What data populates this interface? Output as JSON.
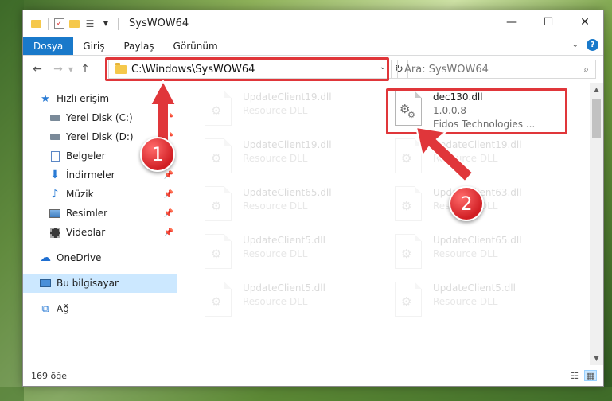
{
  "window": {
    "title": "SysWOW64",
    "controls": [
      "minimize-icon",
      "maximize-icon",
      "close-icon"
    ]
  },
  "ribbon": {
    "tabs": [
      "Dosya",
      "Giriş",
      "Paylaş",
      "Görünüm"
    ]
  },
  "navigation": {
    "address": "C:\\Windows\\SysWOW64",
    "search_placeholder": "Ara: SysWOW64"
  },
  "sidebar": {
    "items": [
      {
        "label": "Hızlı erişim",
        "icon": "star-icon",
        "pinned": false
      },
      {
        "label": "Yerel Disk (C:)",
        "icon": "drive-icon",
        "pinned": true
      },
      {
        "label": "Yerel Disk (D:)",
        "icon": "drive-icon",
        "pinned": true
      },
      {
        "label": "Belgeler",
        "icon": "documents-icon",
        "pinned": true
      },
      {
        "label": "İndirmeler",
        "icon": "download-icon",
        "pinned": true
      },
      {
        "label": "Müzik",
        "icon": "music-icon",
        "pinned": true
      },
      {
        "label": "Resimler",
        "icon": "pictures-icon",
        "pinned": true
      },
      {
        "label": "Videolar",
        "icon": "video-icon",
        "pinned": true
      },
      {
        "label": "OneDrive",
        "icon": "cloud-icon",
        "pinned": false
      },
      {
        "label": "Bu bilgisayar",
        "icon": "computer-icon",
        "pinned": false,
        "selected": true
      },
      {
        "label": "Ağ",
        "icon": "network-icon",
        "pinned": false
      }
    ]
  },
  "files": {
    "highlighted": {
      "name": "dec130.dll",
      "version": "1.0.0.8",
      "company": "Eidos Technologies ..."
    },
    "background": [
      {
        "name": "UpdateClient19.dll",
        "desc": "Resource DLL"
      },
      {
        "name": "UpdateClient19.dll",
        "desc": "Resource DLL"
      },
      {
        "name": "UpdateClient19.dll",
        "desc": "Resource DLL"
      },
      {
        "name": "UpdateClient65.dll",
        "desc": "Resource DLL"
      },
      {
        "name": "UpdateClient63.dll",
        "desc": "Resource DLL"
      },
      {
        "name": "UpdateClient5.dll",
        "desc": "Resource DLL"
      },
      {
        "name": "UpdateClient65.dll",
        "desc": "Resource DLL"
      },
      {
        "name": "UpdateClient5.dll",
        "desc": "Resource DLL"
      },
      {
        "name": "UpdateClient5.dll",
        "desc": "Resource DLL"
      }
    ]
  },
  "status": {
    "item_count": "169 öğe"
  },
  "annotations": {
    "step1": "1",
    "step2": "2",
    "color": "#e0363a"
  }
}
